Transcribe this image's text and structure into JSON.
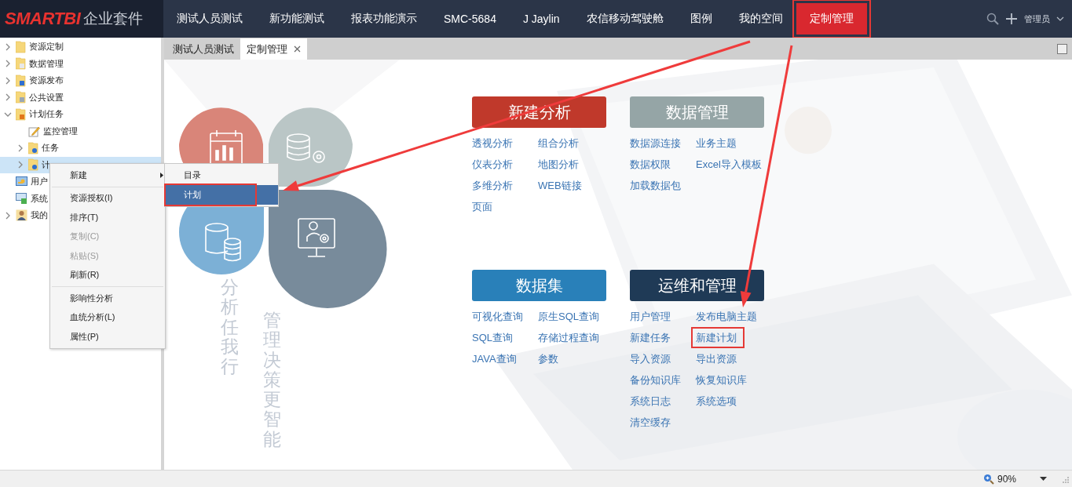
{
  "logo": {
    "brand": "SMARTBI",
    "product": "企业套件"
  },
  "nav": [
    {
      "label": "测试人员测试",
      "selected": false,
      "annotated": false
    },
    {
      "label": "新功能测试",
      "selected": false,
      "annotated": false
    },
    {
      "label": "报表功能演示",
      "selected": false,
      "annotated": false
    },
    {
      "label": "SMC-5684",
      "selected": false,
      "annotated": false
    },
    {
      "label": "J Jaylin",
      "selected": false,
      "annotated": false
    },
    {
      "label": "农信移动驾驶舱",
      "selected": false,
      "annotated": false
    },
    {
      "label": "图例",
      "selected": false,
      "annotated": false
    },
    {
      "label": "我的空间",
      "selected": false,
      "annotated": false
    },
    {
      "label": "定制管理",
      "selected": true,
      "annotated": true
    }
  ],
  "user": {
    "name": "管理员"
  },
  "tree": [
    {
      "label": "资源定制",
      "kind": "folder",
      "expanded": false,
      "selected": false
    },
    {
      "label": "数据管理",
      "kind": "data",
      "expanded": false,
      "selected": false
    },
    {
      "label": "资源发布",
      "kind": "publish",
      "expanded": false,
      "selected": false
    },
    {
      "label": "公共设置",
      "kind": "settings",
      "expanded": false,
      "selected": false
    },
    {
      "label": "计划任务",
      "kind": "task",
      "expanded": true,
      "selected": false,
      "children": [
        {
          "label": "监控管理",
          "kind": "monitor",
          "selected": false
        },
        {
          "label": "任务",
          "kind": "taskitem",
          "expanded": false,
          "selected": false
        },
        {
          "label": "计",
          "kind": "plan",
          "expanded": false,
          "selected": true
        }
      ]
    },
    {
      "label": "用户",
      "kind": "user",
      "selected": false
    },
    {
      "label": "系统",
      "kind": "system",
      "selected": false
    },
    {
      "label": "我的",
      "kind": "person",
      "expanded": false,
      "selected": false
    }
  ],
  "tabs": [
    {
      "label": "测试人员测试",
      "selected": false,
      "closable": false
    },
    {
      "label": "定制管理",
      "selected": true,
      "closable": true
    }
  ],
  "context_menu": [
    {
      "kind": "submenu",
      "label": "新建",
      "disabled": false
    },
    {
      "kind": "separator"
    },
    {
      "kind": "item",
      "label": "资源授权(I)",
      "disabled": false
    },
    {
      "kind": "item",
      "label": "排序(T)",
      "disabled": false
    },
    {
      "kind": "item",
      "label": "复制(C)",
      "disabled": true
    },
    {
      "kind": "item",
      "label": "粘贴(S)",
      "disabled": true
    },
    {
      "kind": "item",
      "label": "刷新(R)",
      "disabled": false
    },
    {
      "kind": "separator"
    },
    {
      "kind": "item",
      "label": "影响性分析",
      "disabled": false
    },
    {
      "kind": "item",
      "label": "血统分析(L)",
      "disabled": false
    },
    {
      "kind": "item",
      "label": "属性(P)",
      "disabled": false
    }
  ],
  "submenu": [
    {
      "label": "目录",
      "selected": false,
      "annotated": false
    },
    {
      "label": "计划",
      "selected": true,
      "annotated": true
    }
  ],
  "slogans": [
    "分析任我行",
    "管理决策更智能"
  ],
  "sections": [
    {
      "title": "新建分析",
      "color": "#c0392b",
      "links": [
        {
          "label": "透视分析",
          "annotated": false
        },
        {
          "label": "组合分析",
          "annotated": false
        },
        {
          "label": "仪表分析",
          "annotated": false
        },
        {
          "label": "地图分析",
          "annotated": false
        },
        {
          "label": "多维分析",
          "annotated": false
        },
        {
          "label": "WEB链接",
          "annotated": false
        },
        {
          "label": "页面",
          "annotated": false
        }
      ]
    },
    {
      "title": "数据管理",
      "color": "#95a5a6",
      "links": [
        {
          "label": "数据源连接",
          "annotated": false
        },
        {
          "label": "业务主题",
          "annotated": false
        },
        {
          "label": "数据权限",
          "annotated": false
        },
        {
          "label": "Excel导入模板",
          "annotated": false
        },
        {
          "label": "加载数据包",
          "annotated": false
        }
      ]
    },
    {
      "title": "数据集",
      "color": "#2980b9",
      "links": [
        {
          "label": "可视化查询",
          "annotated": false
        },
        {
          "label": "原生SQL查询",
          "annotated": false
        },
        {
          "label": "SQL查询",
          "annotated": false
        },
        {
          "label": "存储过程查询",
          "annotated": false
        },
        {
          "label": "JAVA查询",
          "annotated": false
        },
        {
          "label": "参数",
          "annotated": false
        }
      ]
    },
    {
      "title": "运维和管理",
      "color": "#1f3a56",
      "links": [
        {
          "label": "用户管理",
          "annotated": false
        },
        {
          "label": "发布电脑主题",
          "annotated": false
        },
        {
          "label": "新建任务",
          "annotated": false
        },
        {
          "label": "新建计划",
          "annotated": true
        },
        {
          "label": "导入资源",
          "annotated": false
        },
        {
          "label": "导出资源",
          "annotated": false
        },
        {
          "label": "备份知识库",
          "annotated": false
        },
        {
          "label": "恢复知识库",
          "annotated": false
        },
        {
          "label": "系统日志",
          "annotated": false
        },
        {
          "label": "系统选项",
          "annotated": false
        },
        {
          "label": "清空缓存",
          "annotated": false
        }
      ]
    }
  ],
  "status_bar": {
    "zoom": "90%"
  }
}
